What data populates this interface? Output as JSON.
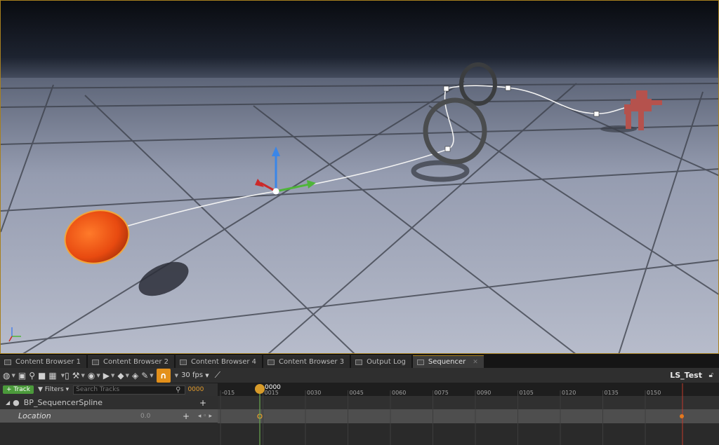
{
  "tabs": [
    {
      "label": "Content Browser 1",
      "active": false
    },
    {
      "label": "Content Browser 2",
      "active": false
    },
    {
      "label": "Content Browser 4",
      "active": false
    },
    {
      "label": "Content Browser 3",
      "active": false
    },
    {
      "label": "Output Log",
      "active": false
    },
    {
      "label": "Sequencer",
      "active": true
    }
  ],
  "toolbar": {
    "icons": [
      "world-icon",
      "save-icon",
      "search-icon",
      "camera-icon",
      "clapper-icon",
      "render-icon",
      "wrench-icon",
      "eye-icon",
      "play-icon",
      "keyframe-icon",
      "auto-key-icon",
      "brush-icon",
      "magnet-icon",
      "curve-icon"
    ],
    "fps": "30 fps",
    "sequence_name": "LS_Test"
  },
  "tracks_panel": {
    "add_track": "+ Track",
    "filters": "Filters",
    "search_placeholder": "Search Tracks",
    "current_time": "0000",
    "object_name": "BP_SequencerSpline",
    "track_name": "Location",
    "track_value": "0.0"
  },
  "timeline": {
    "playhead_label": "0000",
    "ticks": [
      "-015",
      "0015",
      "0030",
      "0045",
      "0060",
      "0075",
      "0090",
      "0105",
      "0120",
      "0135",
      "0150"
    ]
  },
  "colors": {
    "accent": "#a8801e",
    "playhead": "#d79b2a",
    "track_button": "#4b9a3b",
    "magnet": "#e3901a",
    "sphere": "#e84a10"
  }
}
